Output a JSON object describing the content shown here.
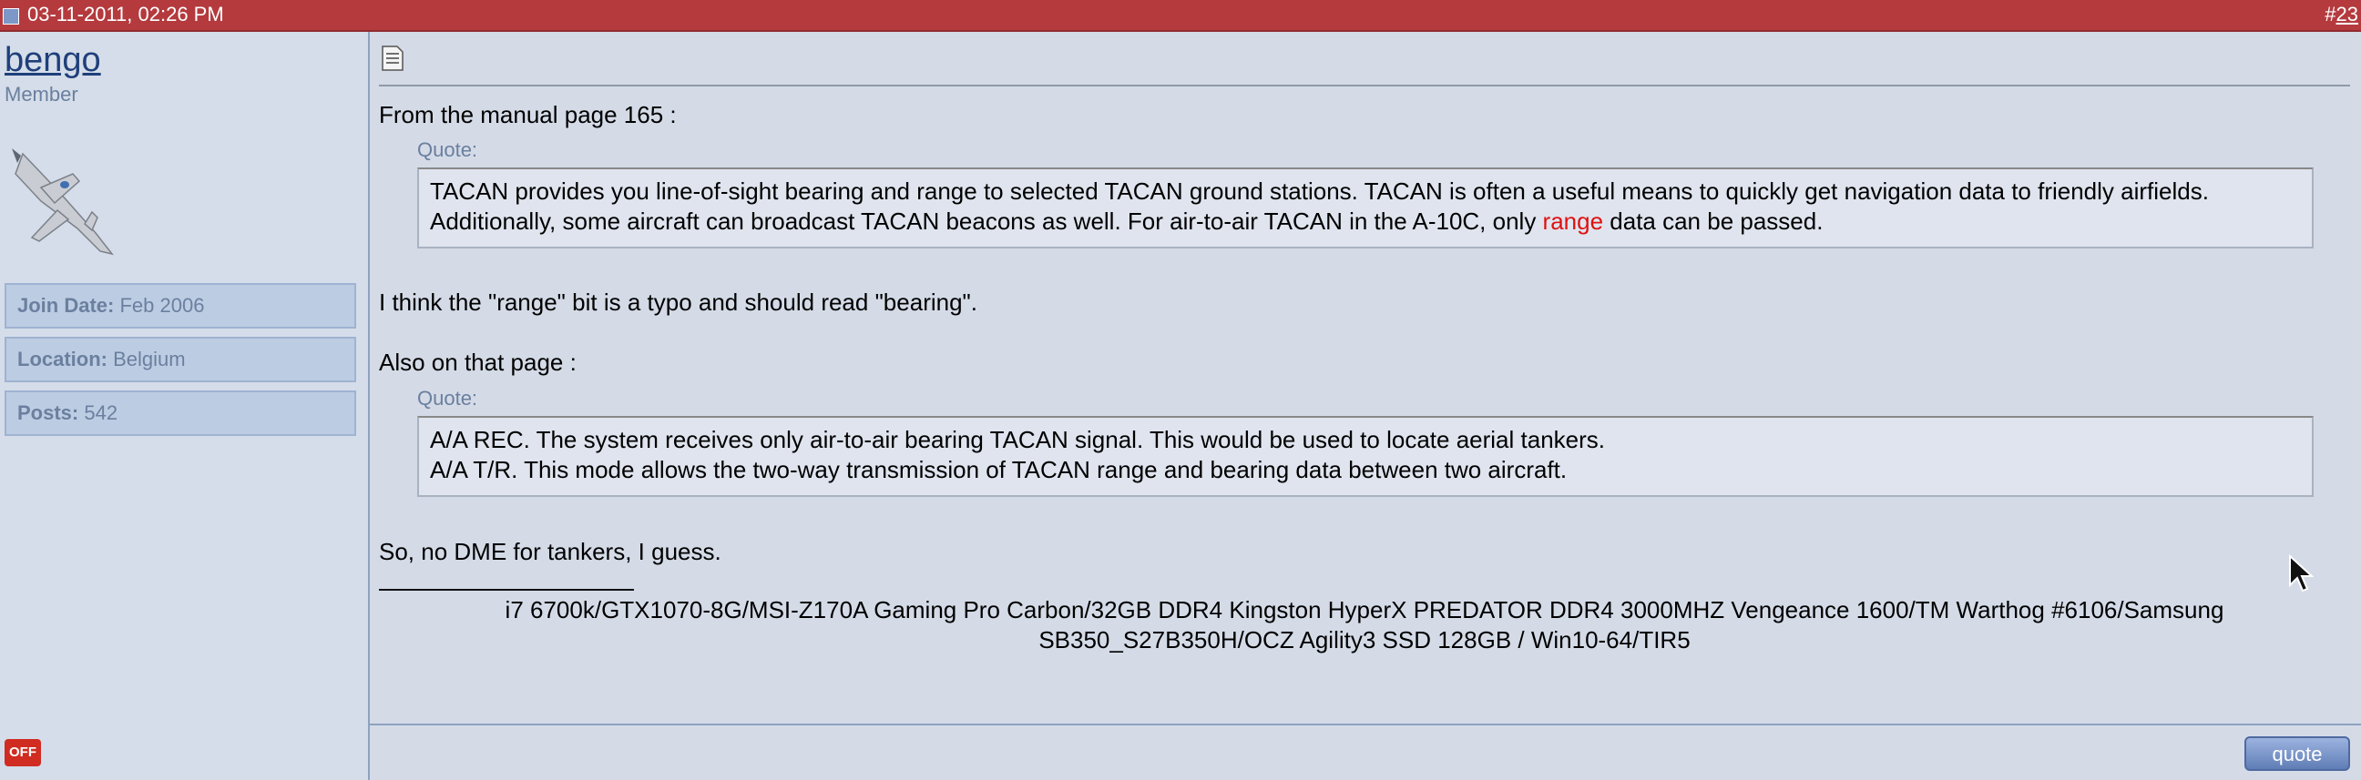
{
  "header": {
    "date": "03-11-2011, 02:26 PM",
    "post_hash": "#",
    "post_number": "23"
  },
  "user": {
    "name": "bengo",
    "title": "Member",
    "join_label": "Join Date:",
    "join_value": "Feb 2006",
    "location_label": "Location:",
    "location_value": "Belgium",
    "posts_label": "Posts:",
    "posts_value": "542",
    "status": "OFF"
  },
  "post": {
    "intro": "From the manual page 165 :",
    "quote_label": "Quote:",
    "quote1_before": "TACAN provides you line-of-sight bearing and range to selected TACAN ground stations. TACAN is often a useful means to quickly get navigation data to friendly airfields. Additionally, some aircraft can broadcast TACAN beacons as well. For air-to-air TACAN in the A-10C, only ",
    "quote1_highlight": "range",
    "quote1_after": " data can be passed.",
    "line2": "I think the \"range\" bit is a typo and should read \"bearing\".",
    "line3": "Also on that page :",
    "quote2_line1": "A/A REC. The system receives only air-to-air bearing TACAN signal. This would be used to locate aerial tankers.",
    "quote2_line2": "A/A T/R. This mode allows the two-way transmission of TACAN range and bearing data between two aircraft.",
    "line4": "So, no DME for tankers, I guess.",
    "signature_underline": "__________________",
    "signature": "i7 6700k/GTX1070-8G/MSI-Z170A Gaming Pro Carbon/32GB DDR4 Kingston HyperX PREDATOR DDR4 3000MHZ Vengeance 1600/TM Warthog #6106/Samsung SB350_S27B350H/OCZ Agility3 SSD 128GB / Win10-64/TIR5"
  },
  "footer": {
    "quote_button": "quote"
  },
  "icons": {
    "post_icon": "document-icon",
    "header_icon": "post-icon",
    "avatar": "f18-jet-avatar",
    "cursor": "mouse-cursor"
  },
  "colors": {
    "header_bg": "#b43a3e",
    "highlight": "#e01010",
    "status_off": "#d02c21"
  }
}
